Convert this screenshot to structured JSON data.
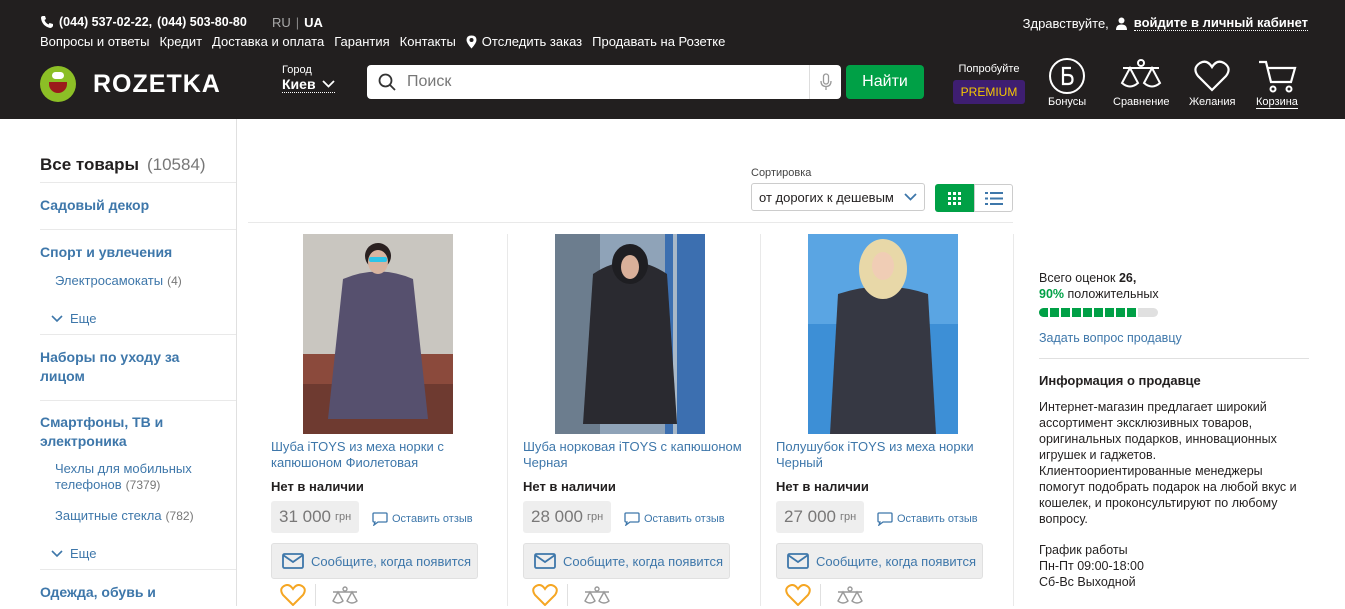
{
  "header": {
    "phones_main": "(044) 537-02-22,",
    "phones_alt": "(044) 503-80-80",
    "lang_ru": "RU",
    "lang_ua": "UA",
    "hello": "Здравствуйте,",
    "login": "войдите в личный кабинет",
    "nav": [
      "Вопросы и ответы",
      "Кредит",
      "Доставка и оплата",
      "Гарантия",
      "Контакты"
    ],
    "track": "Отследить заказ",
    "sell": "Продавать на Розетке",
    "logo": "ROZETKA",
    "city_label": "Город",
    "city_value": "Киев",
    "search_placeholder": "Поиск",
    "find_button": "Найти",
    "premium_try": "Попробуйте",
    "premium_label": "PREMIUM",
    "icons": {
      "bonus": "Бонусы",
      "compare": "Сравнение",
      "wishlist": "Желания",
      "cart": "Корзина"
    }
  },
  "sidebar": {
    "all_label": "Все товары",
    "all_count": "(10584)",
    "cat_garden": "Садовый декор",
    "cat_sport": "Спорт и увлечения",
    "sub_scooters": "Электросамокаты",
    "sub_scooters_count": "(4)",
    "more": "Еще",
    "cat_care": "Наборы по уходу за лицом",
    "cat_phones": "Смартфоны, ТВ и электроника",
    "sub_cases": "Чехлы для мобильных телефонов",
    "sub_cases_count": "(7379)",
    "sub_glass": "Защитные стекла",
    "sub_glass_count": "(782)",
    "cat_clothes": "Одежда, обувь и"
  },
  "sort": {
    "label": "Сортировка",
    "value": "от дорогих к дешевым"
  },
  "products": [
    {
      "title": "Шуба iTOYS из меха норки с капюшоном Фиолетовая",
      "availability": "Нет в наличии",
      "price": "31 000",
      "currency": "грн",
      "review": "Оставить отзыв",
      "notify": "Сообщите, когда появится",
      "coat_color": "#56506e"
    },
    {
      "title": "Шуба норковая iTOYS с капюшоном Черная",
      "availability": "Нет в наличии",
      "price": "28 000",
      "currency": "грн",
      "review": "Оставить отзыв",
      "notify": "Сообщите, когда появится",
      "coat_color": "#2a2a30"
    },
    {
      "title": "Полушубок iTOYS из меха норки Черный",
      "availability": "Нет в наличии",
      "price": "27 000",
      "currency": "грн",
      "review": "Оставить отзыв",
      "notify": "Сообщите, когда появится",
      "coat_color": "#363843"
    }
  ],
  "seller": {
    "ratings_label": "Всего оценок",
    "ratings_count": "26,",
    "positive_pct": "90%",
    "positive_label": "положительных",
    "positive_fraction": 0.9,
    "ask": "Задать вопрос продавцу",
    "info_heading": "Информация о продавце",
    "description": "Интернет-магазин предлагает широкий ассортимент эксклюзивных товаров, оригинальных подарков, инновационных игрушек и гаджетов. Клиентоориентированные менеджеры помогут подобрать подарок на любой вкус и кошелек, и проконсультируют по любому вопросу.",
    "schedule_title": "График работы",
    "schedule_weekdays": "Пн-Пт 09:00-18:00",
    "schedule_weekend": "Сб-Вс Выходной"
  },
  "colors": {
    "header_bg": "#221f1f",
    "accent_green": "#00a046",
    "link_blue": "#3e77aa",
    "premium_bg": "#3e1e71"
  }
}
